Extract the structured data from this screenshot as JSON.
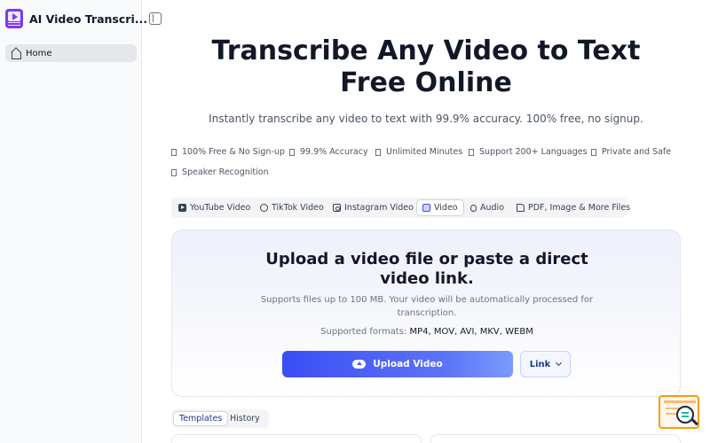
{
  "app": {
    "name": "AI Video Transcri..."
  },
  "sidebar": {
    "items": [
      {
        "label": "Home",
        "icon": "home-icon"
      }
    ]
  },
  "hero": {
    "title_line1": "Transcribe Any Video to Text",
    "title_line2": "Free Online",
    "subtitle": "Instantly transcribe any video to text with 99.9% accuracy. 100% free, no signup."
  },
  "features": [
    "100% Free & No Sign-up",
    "99.9% Accuracy",
    "Unlimited Minutes",
    "Support 200+ Languages",
    "Private and Safe",
    "Speaker Recognition"
  ],
  "source_tabs": [
    {
      "label": "YouTube Video",
      "icon": "youtube-icon"
    },
    {
      "label": "TikTok Video",
      "icon": "tiktok-icon"
    },
    {
      "label": "Instagram Video",
      "icon": "instagram-icon"
    },
    {
      "label": "Video",
      "icon": "video-icon",
      "active": true
    },
    {
      "label": "Audio",
      "icon": "audio-icon"
    },
    {
      "label": "PDF, Image & More Files",
      "icon": "file-icon"
    }
  ],
  "upload": {
    "title_line1": "Upload a video file or paste a direct",
    "title_line2": "video link.",
    "desc_line1": "Supports files up to 100 MB. Your video will be automatically processed for",
    "desc_line2": "transcription.",
    "formats_label": "Supported formats: ",
    "formats": "MP4, MOV, AVI, MKV, WEBM",
    "upload_button": "Upload Video",
    "link_button": "Link"
  },
  "bottom_tabs": [
    {
      "label": "Templates",
      "active": true
    },
    {
      "label": "History"
    }
  ],
  "colors": {
    "accent": "#3b4ef5",
    "brand_purple": "#7c3aed",
    "sidebar_bg": "#f9fafb"
  }
}
